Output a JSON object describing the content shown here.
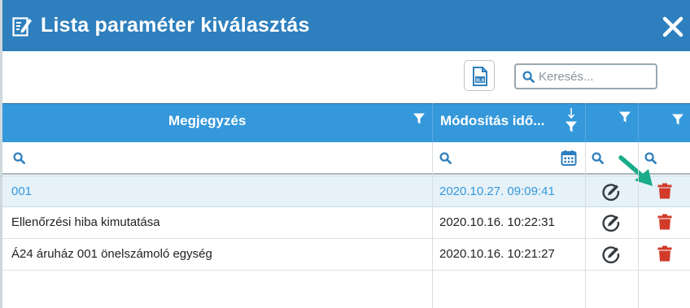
{
  "dialog": {
    "title": "Lista paraméter kiválasztás"
  },
  "toolbar": {
    "search_placeholder": "Keresés..."
  },
  "grid": {
    "columns": [
      {
        "label": "Megjegyzés"
      },
      {
        "label": "Módosítás idő..."
      },
      {
        "label": ""
      },
      {
        "label": ""
      }
    ],
    "rows": [
      {
        "note": "001",
        "modified": "2020.10.27. 09:09:41",
        "selected": true
      },
      {
        "note": "Ellenőrzési hiba kimutatása",
        "modified": "2020.10.16. 10:22:31",
        "selected": false
      },
      {
        "note": "Á24 áruház 001 önelszámoló egység",
        "modified": "2020.10.16. 10:21:27",
        "selected": false
      }
    ]
  },
  "colors": {
    "titlebar": "#2e7fbd",
    "header": "#3498db",
    "delete": "#d23b2a",
    "arrow": "#1aab8a"
  },
  "icons": {
    "title": "edit-document-icon",
    "close": "close-icon",
    "export": "file-export-icon",
    "search": "search-icon",
    "filter": "filter-icon",
    "sort": "sort-descending-icon",
    "calendar": "calendar-icon",
    "edit": "edit-circle-icon",
    "delete": "trash-icon"
  }
}
